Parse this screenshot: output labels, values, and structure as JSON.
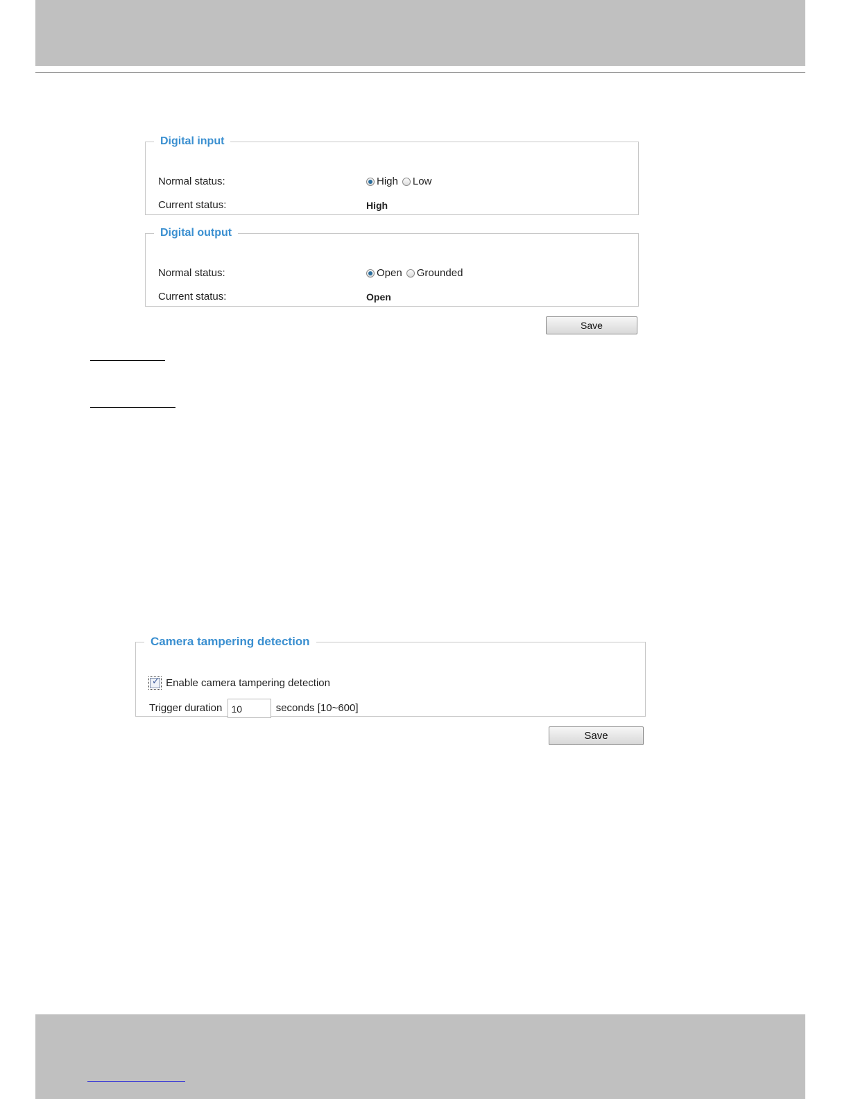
{
  "digital_input": {
    "legend": "Digital input",
    "normal_status_label": "Normal status:",
    "options": [
      "High",
      "Low"
    ],
    "selected": "High",
    "current_status_label": "Current status:",
    "current_status_value": "High"
  },
  "digital_output": {
    "legend": "Digital output",
    "normal_status_label": "Normal status:",
    "options": [
      "Open",
      "Grounded"
    ],
    "selected": "Open",
    "current_status_label": "Current status:",
    "current_status_value": "Open"
  },
  "io_save_label": "Save",
  "tampering": {
    "legend": "Camera tampering detection",
    "enable_label": "Enable camera tampering detection",
    "enabled": true,
    "trigger_label": "Trigger duration",
    "trigger_value": "10",
    "trigger_suffix": "seconds [10~600]"
  },
  "tampering_save_label": "Save",
  "colors": {
    "legend": "#3a8fd0",
    "band": "#c0c0c0"
  }
}
